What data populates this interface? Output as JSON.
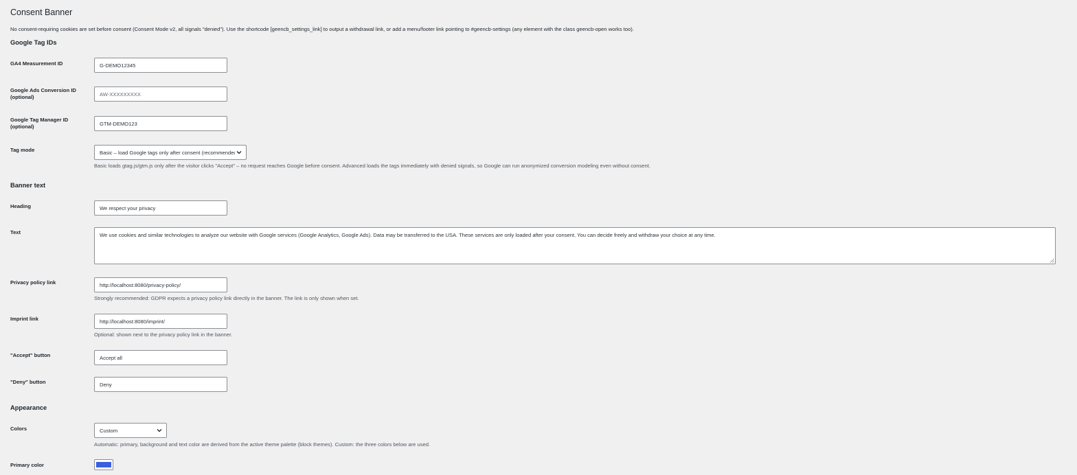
{
  "page": {
    "title": "Consent Banner",
    "notice": "No consent-requiring cookies are set before consent (Consent Mode v2, all signals \"denied\"). Use the shortcode [geencb_settings_link] to output a withdrawal link, or add a menu/footer link pointing to #geencb-settings (any element with the class geencb-open works too)."
  },
  "sections": {
    "tags": "Google Tag IDs",
    "banner": "Banner text",
    "appearance": "Appearance"
  },
  "fields": {
    "ga4": {
      "label": "GA4 Measurement ID",
      "value": "G-DEMO12345"
    },
    "ads": {
      "label_line1": "Google Ads Conversion ID",
      "label_line2": "(optional)",
      "value": "",
      "placeholder": "AW-XXXXXXXXX"
    },
    "gtm": {
      "label_line1": "Google Tag Manager ID",
      "label_line2": "(optional)",
      "value": "GTM-DEMO123"
    },
    "tag_mode": {
      "label": "Tag mode",
      "selected": "Basic – load Google tags only after consent (recommended)",
      "description": "Basic loads gtag.js/gtm.js only after the visitor clicks \"Accept\" – no request reaches Google before consent. Advanced loads the tags immediately with denied signals, so Google can run anonymized conversion modeling even without consent."
    },
    "heading": {
      "label": "Heading",
      "value": "We respect your privacy"
    },
    "text": {
      "label": "Text",
      "value": "We use cookies and similar technologies to analyze our website with Google services (Google Analytics, Google Ads). Data may be transferred to the USA. These services are only loaded after your consent. You can decide freely and withdraw your choice at any time."
    },
    "privacy": {
      "label": "Privacy policy link",
      "value": "http://localhost:8080/privacy-policy/",
      "description": "Strongly recommended: GDPR expects a privacy policy link directly in the banner. The link is only shown when set."
    },
    "imprint": {
      "label": "Imprint link",
      "value": "http://localhost:8080/imprint/",
      "description": "Optional: shown next to the privacy policy link in the banner."
    },
    "accept": {
      "label": "\"Accept\" button",
      "value": "Accept all"
    },
    "deny": {
      "label": "\"Deny\" button",
      "value": "Deny"
    },
    "colors": {
      "label": "Colors",
      "selected": "Custom",
      "description": "Automatic: primary, background and text color are derived from the active theme palette (block themes). Custom: the three colors below are used."
    },
    "primary_color": {
      "label": "Primary color",
      "value": "#3b5fe0"
    }
  },
  "icons": {
    "select_arrow": "chevron-down-icon",
    "resize": "resize-handle-icon"
  },
  "colors": {
    "background": "#f0f0f1",
    "border": "#8c8f94",
    "text": "#1d2327",
    "muted": "#50575e"
  }
}
